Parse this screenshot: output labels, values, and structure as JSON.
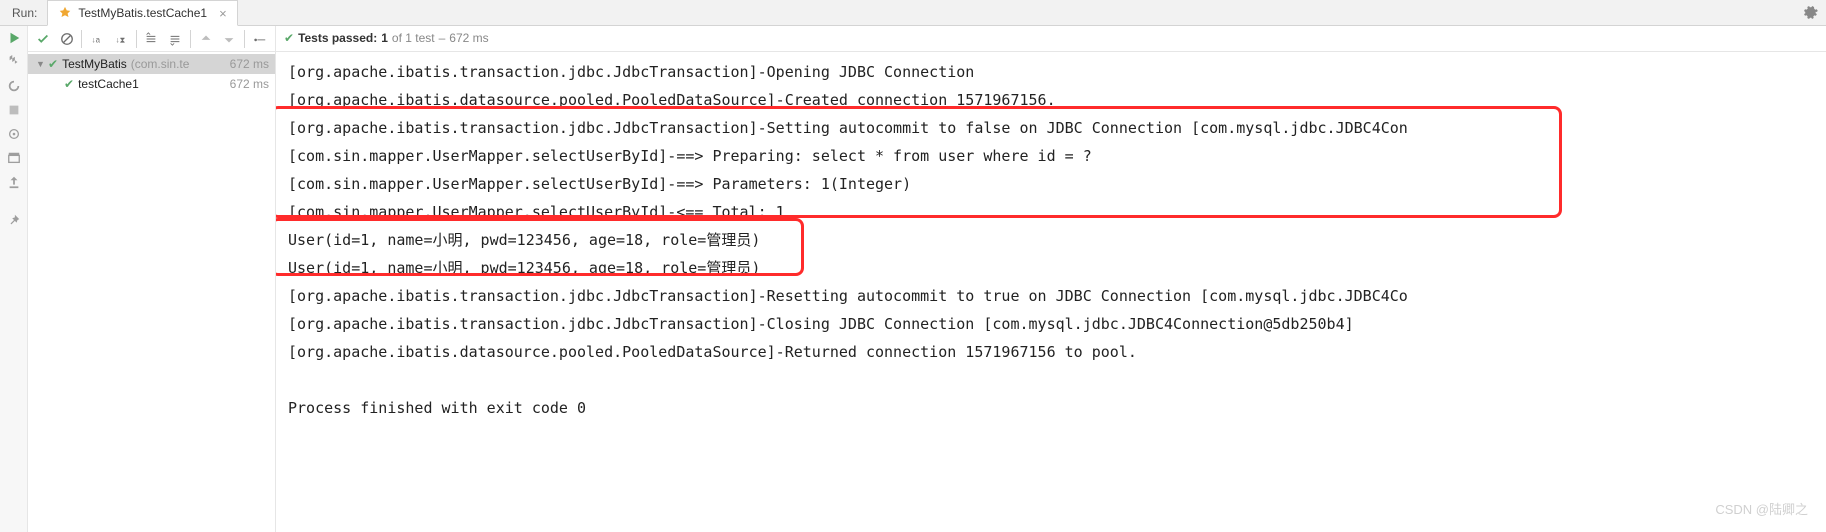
{
  "run_label": "Run:",
  "tab": {
    "title": "TestMyBatis.testCache1"
  },
  "status": {
    "prefix": "Tests passed:",
    "count": "1",
    "of": "of 1 test",
    "dash": "–",
    "time": "672 ms"
  },
  "tree": {
    "root": {
      "name": "TestMyBatis",
      "pkg": "(com.sin.te",
      "time": "672 ms"
    },
    "child": {
      "name": "testCache1",
      "time": "672 ms"
    }
  },
  "console": {
    "lines": [
      "[org.apache.ibatis.transaction.jdbc.JdbcTransaction]-Opening JDBC Connection",
      "[org.apache.ibatis.datasource.pooled.PooledDataSource]-Created connection 1571967156.",
      "[org.apache.ibatis.transaction.jdbc.JdbcTransaction]-Setting autocommit to false on JDBC Connection [com.mysql.jdbc.JDBC4Con",
      "[com.sin.mapper.UserMapper.selectUserById]-==>  Preparing: select * from user where id = ?",
      "[com.sin.mapper.UserMapper.selectUserById]-==> Parameters: 1(Integer)",
      "[com.sin.mapper.UserMapper.selectUserById]-<==      Total: 1",
      "User(id=1, name=小明, pwd=123456, age=18, role=管理员)",
      "User(id=1, name=小明, pwd=123456, age=18, role=管理员)",
      "[org.apache.ibatis.transaction.jdbc.JdbcTransaction]-Resetting autocommit to true on JDBC Connection [com.mysql.jdbc.JDBC4Co",
      "[org.apache.ibatis.transaction.jdbc.JdbcTransaction]-Closing JDBC Connection [com.mysql.jdbc.JDBC4Connection@5db250b4]",
      "[org.apache.ibatis.datasource.pooled.PooledDataSource]-Returned connection 1571967156 to pool."
    ],
    "exit": "Process finished with exit code 0"
  },
  "watermark": "CSDN @陆卿之"
}
